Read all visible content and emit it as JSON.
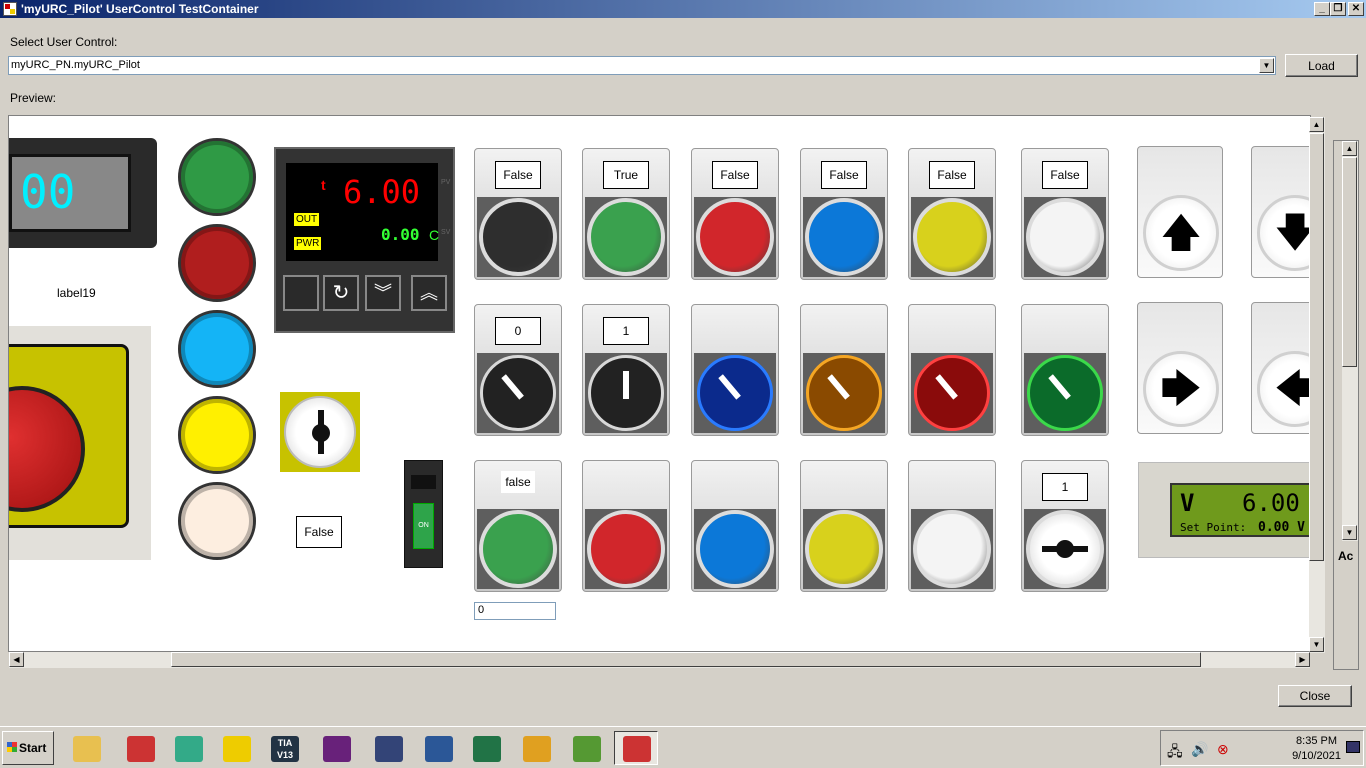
{
  "window": {
    "title": "'myURC_Pilot' UserControl TestContainer",
    "minimize": "_",
    "restore": "❐",
    "close": "✕"
  },
  "form": {
    "select_label": "Select User Control:",
    "combo_value": "myURC_PN.myURC_Pilot",
    "load_label": "Load",
    "preview_label": "Preview:",
    "close_label": "Close"
  },
  "preview": {
    "display_value": "00",
    "label19": "label19",
    "controller": {
      "pv_value": "6.00",
      "pv_unit": "t",
      "sv_value": "0.00",
      "sv_unit": "C",
      "out_label": "OUT",
      "pwr_label": "PWR",
      "pv_tag": "PV",
      "sv_tag": "SV"
    },
    "key_switch_state": "False",
    "toggle_switch_label": "ON",
    "row1_states": [
      "False",
      "True",
      "False",
      "False",
      "False",
      "False"
    ],
    "row1_colors": [
      "#2e2e2e",
      "#3aa14e",
      "#d1262b",
      "#0c78d8",
      "#d8d11c",
      "#f4f4f4"
    ],
    "row2_states": [
      "0",
      "1"
    ],
    "row2_knob_colors": [
      "#222222",
      "#222222",
      "#0b2a8c",
      "#8a4a00",
      "#8a0b0b",
      "#0b6b2a"
    ],
    "row2_ring_colors": [
      "#d8d8d8",
      "#d8d8d8",
      "#2a7bff",
      "#f5a623",
      "#ff4040",
      "#3bd94a"
    ],
    "row3_state": "false",
    "row3_input": "0",
    "row3_colors": [
      "#3aa14e",
      "#d1262b",
      "#0c78d8",
      "#d8d11c",
      "#f4f4f4"
    ],
    "row3_selector_value": "1",
    "pilot_colors": [
      "#2f9a45",
      "#b01e1e",
      "#14b4f6",
      "#fff000",
      "#fdeee0"
    ],
    "arrow_glyphs": [
      "🡅",
      "🡇",
      "🡆",
      "🡄"
    ],
    "lcd": {
      "unit": "V",
      "value": "6.00",
      "setpoint_label": "Set Point:",
      "setpoint_value": "0.00 V"
    }
  },
  "side_panel": {
    "acc_label": "Ac"
  },
  "taskbar": {
    "start_label": "Start",
    "icons": [
      "explorer-icon",
      "acrobat-icon",
      "automation-studio-icon",
      "labview-icon",
      "tia-portal-icon",
      "visual-studio-icon",
      "atom-icon",
      "word-icon",
      "excel-icon",
      "factory-icon",
      "search-app-icon",
      "test-container-icon"
    ],
    "tia_label": "TIA V13",
    "clock_time": "8:35 PM",
    "clock_date": "9/10/2021"
  }
}
